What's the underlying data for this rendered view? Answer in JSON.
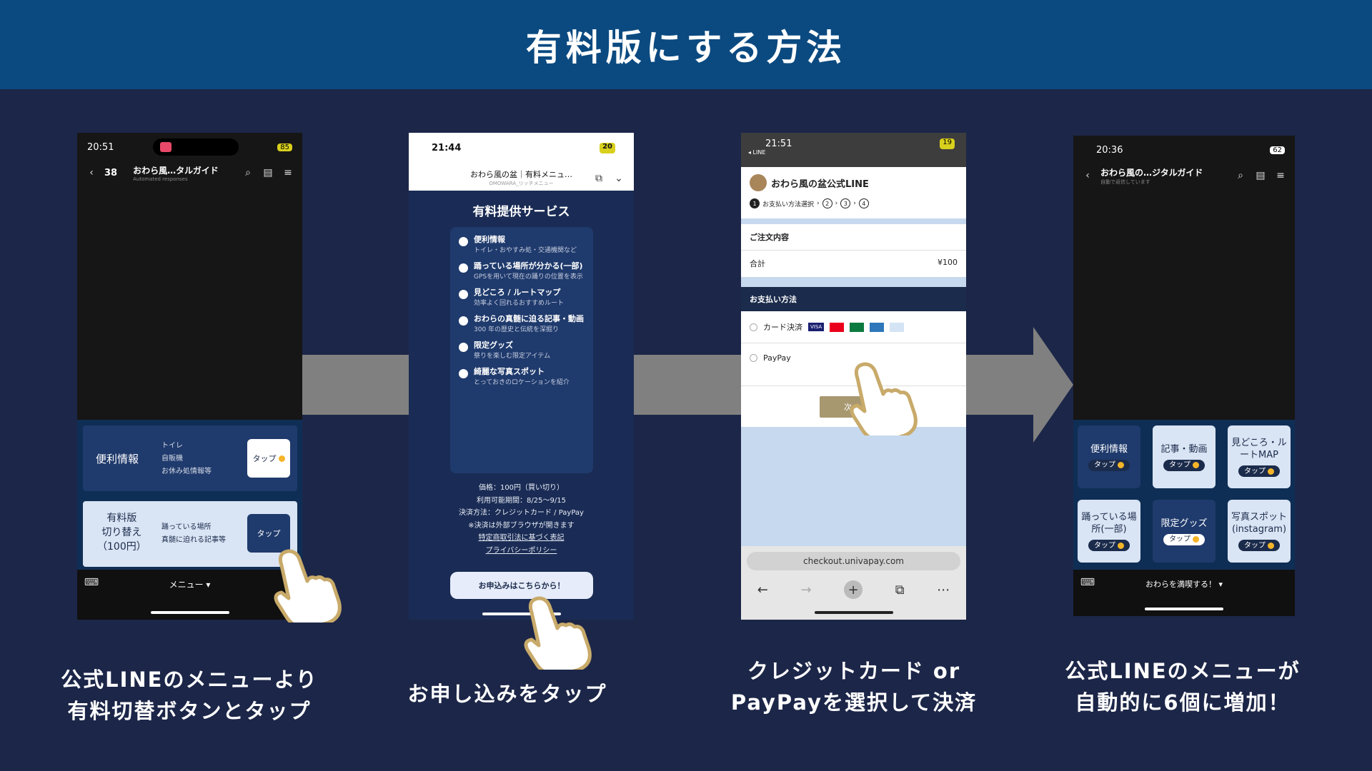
{
  "header": {
    "title": "有料版にする方法"
  },
  "captions": {
    "step1": [
      "公式LINEのメニューより",
      "有料切替ボタンとタップ"
    ],
    "step2": [
      "お申し込みをタップ"
    ],
    "step3": [
      "クレジットカード or",
      "PayPayを選択して決済"
    ],
    "step4": [
      "公式LINEのメニューが",
      "自動的に6個に増加！"
    ]
  },
  "phone1": {
    "time": "20:51",
    "battery": "85",
    "back_count": "38",
    "chat_title": "おわら風…タルガイド",
    "chat_sub": "Automated responses",
    "card1": {
      "title": "便利情報",
      "lines": [
        "トイレ",
        "自販機",
        "お休み処情報等"
      ],
      "button": "タップ"
    },
    "card2": {
      "title_lines": [
        "有料版",
        "切り替え",
        "（100円）"
      ],
      "lines": [
        "踊っている場所",
        "真髄に迫れる記事等"
      ],
      "button": "タップ"
    },
    "menu_label": "メニュー ▾"
  },
  "phone2": {
    "time": "21:44",
    "battery": "20",
    "title": "おわら風の盆｜有料メニュ…",
    "subtitle": "OMOWARA_リッチメニュー",
    "heading": "有料提供サービス",
    "services": [
      {
        "title": "便利情報",
        "desc": "トイレ・おやすみ処・交通機関など"
      },
      {
        "title": "踊っている場所が分かる(一部)",
        "desc": "GPSを用いて現在の踊りの位置を表示"
      },
      {
        "title": "見どころ / ルートマップ",
        "desc": "効率よく回れるおすすめルート"
      },
      {
        "title": "おわらの真髄に迫る記事・動画",
        "desc": "300 年の歴史と伝統を深掘り"
      },
      {
        "title": "限定グッズ",
        "desc": "祭りを楽しむ限定アイテム"
      },
      {
        "title": "綺麗な写真スポット",
        "desc": "とっておきのロケーションを紹介"
      }
    ],
    "info": [
      "価格：100円（買い切り）",
      "利用可能期間：8/25〜9/15",
      "決済方法：クレジットカード / PayPay",
      "※決済は外部ブラウザが開きます"
    ],
    "links": [
      "特定商取引法に基づく表記",
      "プライバシーポリシー"
    ],
    "apply": "お申込みはこちらから！"
  },
  "phone3": {
    "time": "21:51",
    "battery": "19",
    "back_app": "◂ LINE",
    "shop": "おわら風の盆公式LINE",
    "step_label": "お支払い方法選択",
    "order_heading": "ご注文内容",
    "total_label": "合計",
    "total_value": "¥100",
    "pay_heading": "お支払い方法",
    "card_option": "カード決済",
    "card_brands": [
      "VISA",
      "MC",
      "JCB",
      "AMEX",
      "DC"
    ],
    "paypay_option": "PayPay",
    "next_button": "次へ",
    "url": "checkout.univapay.com"
  },
  "phone4": {
    "time": "20:36",
    "battery": "62",
    "chat_title": "おわら風の…ジタルガイド",
    "chat_sub": "自動で返信しています",
    "tiles": [
      {
        "label": "便利情報",
        "button": "タップ"
      },
      {
        "label": "記事・動画",
        "button": "タップ"
      },
      {
        "label": "見どころ・ルートMAP",
        "button": "タップ"
      },
      {
        "label": "踊っている場所(一部)",
        "button": "タップ"
      },
      {
        "label": "限定グッズ",
        "button": "タップ"
      },
      {
        "label": "写真スポット(instagram)",
        "button": "タップ"
      }
    ],
    "menu_label": "おわらを満喫する！ ▾"
  }
}
